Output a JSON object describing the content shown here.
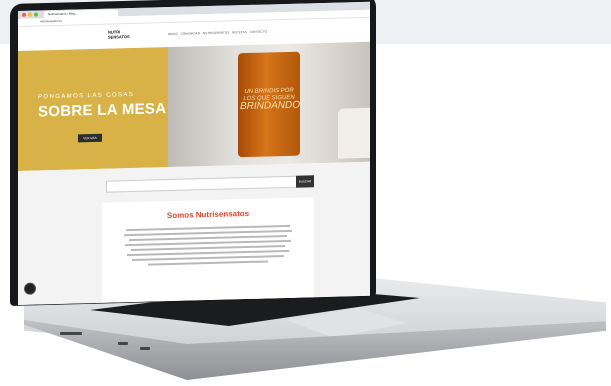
{
  "browser": {
    "tab_title": "Nutrisensatos | Blog...",
    "url": "nutrisensatos.es"
  },
  "site": {
    "logo": "NUTRI SENSATOS",
    "nav": [
      "INICIO",
      "COMUNIDAD",
      "NUTRISENSATOS",
      "RECETAS",
      "CONTACTO"
    ]
  },
  "hero": {
    "small": "PONGAMOS LAS COSAS",
    "big": "SOBRE LA MESA",
    "button": "VER MÁS",
    "glass_text": "UN BRINDIS POR LOS QUE SIGUEN",
    "glass_big": "BRINDANDO"
  },
  "search": {
    "placeholder": "",
    "button": "BUSCAR"
  },
  "card": {
    "heading": "Somos Nutrisensatos"
  },
  "colors": {
    "hero_yellow": "#d8b247",
    "heading_red": "#e0462f",
    "screen_bezel": "#16181b"
  }
}
